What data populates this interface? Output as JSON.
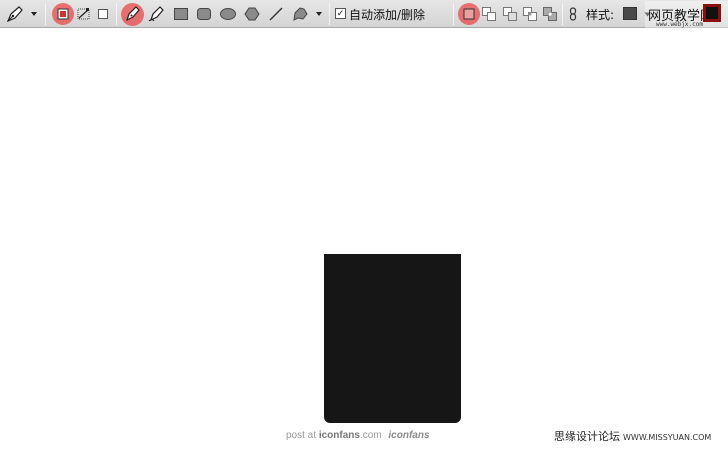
{
  "toolbar": {
    "auto_add_delete_label": "自动添加/删除",
    "style_label": "样式:",
    "auto_add_delete_checked": "✓",
    "accent_color": "#e83232",
    "tools": [
      "pen-tool-icon",
      "shape-layers-icon",
      "paths-icon",
      "fill-pixels-icon",
      "pen-icon",
      "freeform-pen-icon",
      "rectangle-icon",
      "rounded-rectangle-icon",
      "ellipse-icon",
      "polygon-icon",
      "line-icon",
      "custom-shape-icon",
      "new-shape-icon",
      "add-to-shape-icon",
      "subtract-shape-icon",
      "intersect-shape-icon",
      "exclude-shape-icon",
      "link-icon"
    ]
  },
  "watermarks": {
    "top_brand": "网页教学网",
    "top_url": "www.webjx.com",
    "post_at": "post at",
    "site": "iconfans",
    "site_suffix": ".com",
    "site_logo": "iconfans",
    "bottom_brand": "思缘设计论坛",
    "bottom_url": "WWW.MISSYUAN.COM"
  },
  "canvas": {
    "shape_color": "#161616",
    "background": "#ffffff"
  }
}
